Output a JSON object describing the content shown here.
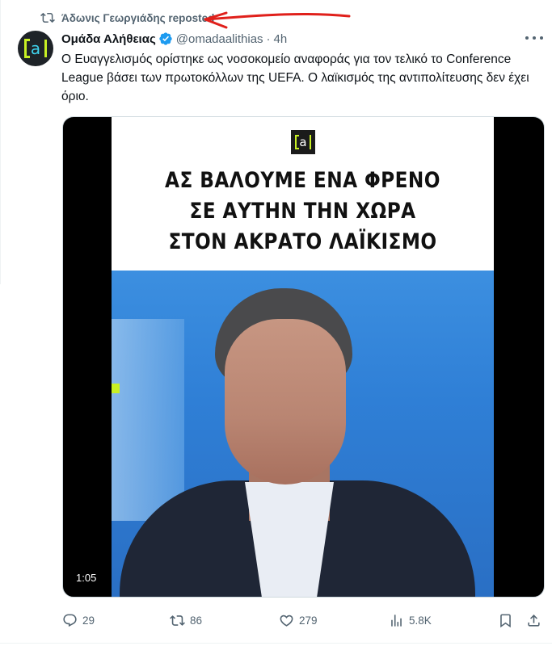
{
  "repost": {
    "label": "Άδωνις Γεωργιάδης reposted",
    "icon": "repost-icon"
  },
  "author": {
    "display_name": "Ομάδα Αλήθειας",
    "handle": "@omadaalithias",
    "separator": "·",
    "time": "4h",
    "verified": true,
    "avatar_glyph": "a",
    "brand_colors": {
      "bracket": "#c8f024",
      "letter": "#3fd3ee",
      "bg": "#1e2328"
    }
  },
  "tweet": {
    "text": "Ο Ευαγγελισμός ορίστηκε ως νοσοκομείο αναφοράς για τον τελικό το Conference League βάσει των πρωτοκόλλων της UEFA. Ο λαϊκισμός της αντιπολίτευσης δεν έχει όριο."
  },
  "media": {
    "logo_glyph": "a",
    "headline": [
      "ΑΣ ΒΑΛΟΥΜΕ ΕΝΑ ΦΡΕΝΟ",
      "ΣΕ ΑΥΤΗΝ ΤΗΝ ΧΩΡΑ",
      "ΣΤΟΝ ΑΚΡΑΤΟ ΛΑΪΚΙΣΜΟ"
    ],
    "duration": "1:05"
  },
  "actions": {
    "replies": "29",
    "reposts": "86",
    "likes": "279",
    "views": "5.8K"
  },
  "colors": {
    "muted": "#536471",
    "text": "#0f1419",
    "verified": "#1d9bf0",
    "annotation": "#e0201b"
  }
}
